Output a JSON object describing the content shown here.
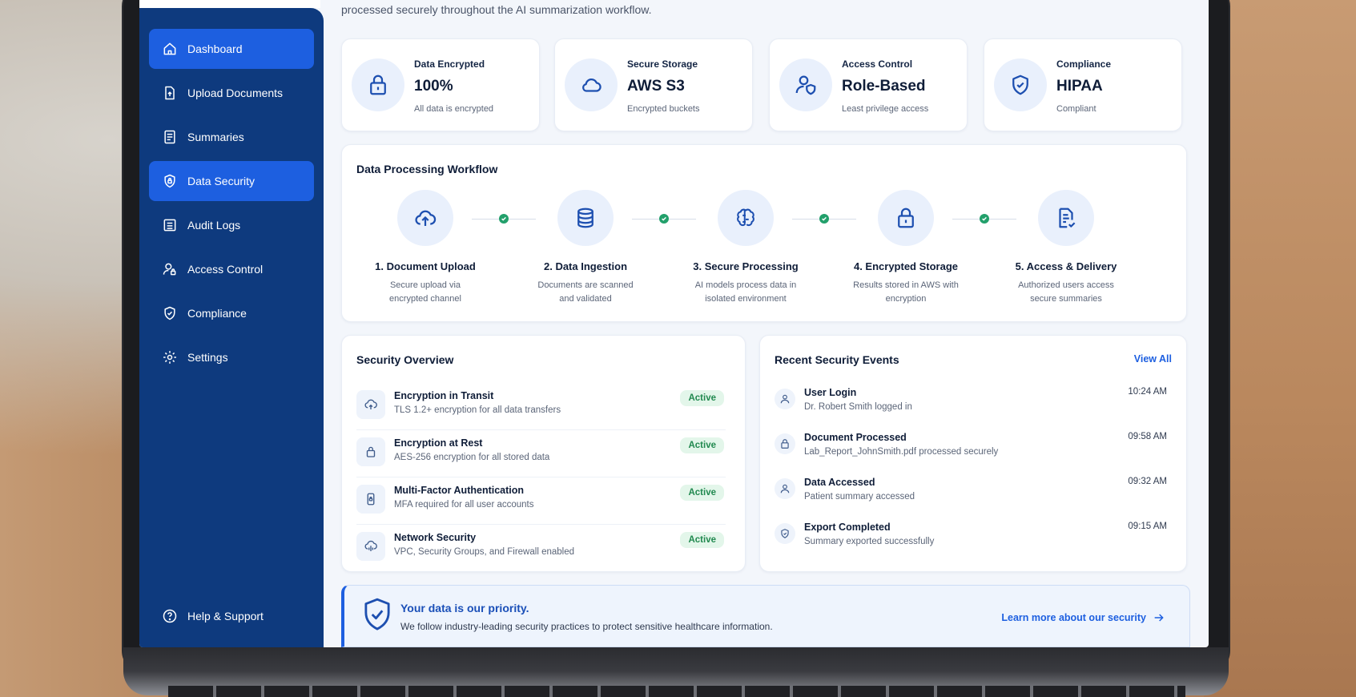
{
  "intro_text": "processed securely throughout the AI summarization workflow.",
  "sidebar": {
    "items": [
      {
        "label": "Dashboard",
        "icon": "home-icon",
        "active": true
      },
      {
        "label": "Upload Documents",
        "icon": "upload-file-icon",
        "active": false
      },
      {
        "label": "Summaries",
        "icon": "document-icon",
        "active": false
      },
      {
        "label": "Data Security",
        "icon": "shield-lock-icon",
        "active": true
      },
      {
        "label": "Audit Logs",
        "icon": "list-icon",
        "active": false
      },
      {
        "label": "Access Control",
        "icon": "user-lock-icon",
        "active": false
      },
      {
        "label": "Compliance",
        "icon": "shield-check-icon",
        "active": false
      },
      {
        "label": "Settings",
        "icon": "gear-icon",
        "active": false
      }
    ],
    "help": {
      "label": "Help & Support",
      "icon": "help-icon"
    }
  },
  "stats": [
    {
      "label": "Data Encrypted",
      "value": "100%",
      "sub": "All data is encrypted",
      "icon": "lock-icon"
    },
    {
      "label": "Secure Storage",
      "value": "AWS S3",
      "sub": "Encrypted buckets",
      "icon": "cloud-icon"
    },
    {
      "label": "Access Control",
      "value": "Role-Based",
      "sub": "Least privilege access",
      "icon": "user-shield-icon"
    },
    {
      "label": "Compliance",
      "value": "HIPAA",
      "sub": "Compliant",
      "icon": "shield-check-icon"
    }
  ],
  "workflow": {
    "title": "Data Processing Workflow",
    "steps": [
      {
        "title": "1. Document Upload",
        "desc": "Secure upload via encrypted channel",
        "icon": "cloud-upload-icon"
      },
      {
        "title": "2. Data Ingestion",
        "desc": "Documents are scanned and validated",
        "icon": "database-icon"
      },
      {
        "title": "3. Secure Processing",
        "desc": "AI models process data in isolated environment",
        "icon": "brain-icon"
      },
      {
        "title": "4. Encrypted Storage",
        "desc": "Results stored in AWS with encryption",
        "icon": "lock-icon"
      },
      {
        "title": "5. Access & Delivery",
        "desc": "Authorized users access secure summaries",
        "icon": "document-check-icon"
      }
    ]
  },
  "overview": {
    "title": "Security Overview",
    "rows": [
      {
        "title": "Encryption in Transit",
        "desc": "TLS 1.2+ encryption for all data transfers",
        "status": "Active",
        "icon": "cloud-transfer-icon"
      },
      {
        "title": "Encryption at Rest",
        "desc": "AES-256 encryption for all stored data",
        "status": "Active",
        "icon": "lock-icon"
      },
      {
        "title": "Multi-Factor Authentication",
        "desc": "MFA required for all user accounts",
        "status": "Active",
        "icon": "phone-lock-icon"
      },
      {
        "title": "Network Security",
        "desc": "VPC, Security Groups, and Firewall enabled",
        "status": "Active",
        "icon": "network-cloud-icon"
      }
    ]
  },
  "events": {
    "title": "Recent Security Events",
    "view_all": "View All",
    "rows": [
      {
        "title": "User Login",
        "desc": "Dr. Robert Smith logged in",
        "time": "10:24 AM",
        "icon": "user-icon"
      },
      {
        "title": "Document Processed",
        "desc": "Lab_Report_JohnSmith.pdf processed securely",
        "time": "09:58 AM",
        "icon": "lock-icon"
      },
      {
        "title": "Data Accessed",
        "desc": "Patient summary accessed",
        "time": "09:32 AM",
        "icon": "user-icon"
      },
      {
        "title": "Export Completed",
        "desc": "Summary exported successfully",
        "time": "09:15 AM",
        "icon": "export-icon"
      }
    ]
  },
  "banner": {
    "title": "Your data is our priority.",
    "desc": "We follow industry-leading security practices to protect sensitive healthcare information.",
    "link": "Learn more about our security"
  },
  "colors": {
    "sidebar": "#0e3a7e",
    "accent": "#1d5fe0",
    "success": "#22a06b"
  }
}
